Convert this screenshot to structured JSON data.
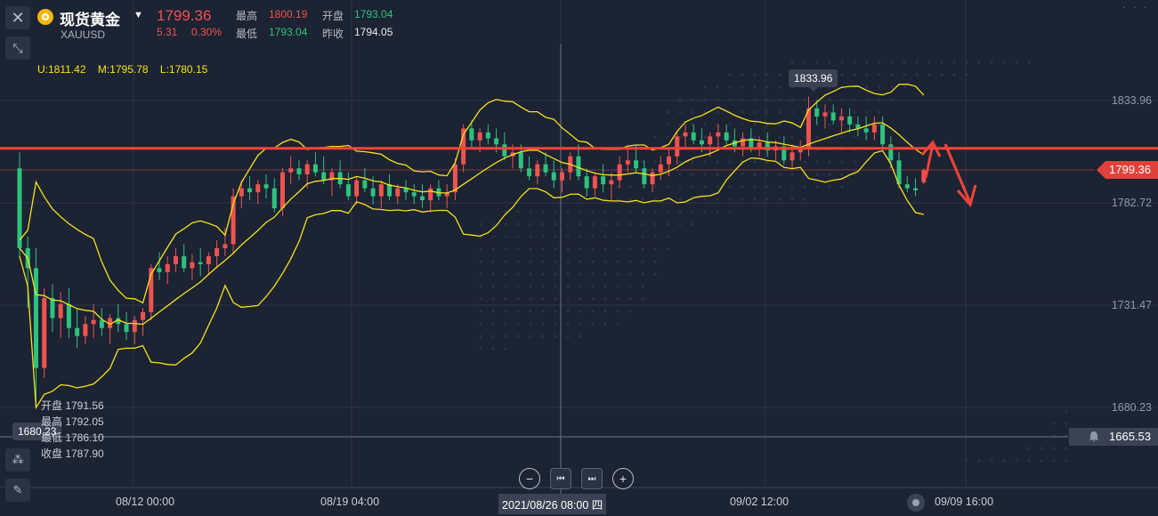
{
  "header": {
    "symbol_name": "现货黄金",
    "symbol_code": "XAUUSD",
    "last_price": "1799.36",
    "change": "5.31",
    "change_pct": "0.30%",
    "high_label": "最高",
    "high_value": "1800.19",
    "open_label": "开盘",
    "open_value": "1793.04",
    "low_label": "最低",
    "low_value": "1793.04",
    "prev_close_label": "昨收",
    "prev_close_value": "1794.05"
  },
  "indicator": {
    "upper": "U:1811.42",
    "middle": "M:1795.78",
    "lower": "L:1780.15",
    "color": "#f4e31d"
  },
  "y_axis": {
    "labels": [
      "1833.96",
      "1782.72",
      "1731.47",
      "1680.23"
    ],
    "current_price_tag": "1799.36",
    "low_tag": "1665.53"
  },
  "x_axis": {
    "labels": [
      "08/12 00:00",
      "08/19 04:00",
      "09/02 12:00",
      "09/09 16:00"
    ],
    "crosshair_date": "2021/08/26 08:00 四"
  },
  "markers": {
    "high_point": "1833.96",
    "low_point": "1680.23"
  },
  "ohlc_tooltip": {
    "open": "开盘 1791.56",
    "high": "最高 1792.05",
    "low": "最低 1786.10",
    "close": "收盘 1787.90"
  },
  "colors": {
    "up": "#ef5350",
    "down": "#2ec27e",
    "background": "#1c2333",
    "support_line": "#f0443a",
    "bollinger": "#f4e31d"
  },
  "chart_data": {
    "type": "candlestick",
    "ylim": [
      1665.53,
      1845
    ],
    "annotation_line": 1810,
    "candles": [
      {
        "o": 1800,
        "h": 1808,
        "l": 1755,
        "c": 1760
      },
      {
        "o": 1760,
        "h": 1766,
        "l": 1730,
        "c": 1750
      },
      {
        "o": 1750,
        "h": 1760,
        "l": 1680,
        "c": 1700
      },
      {
        "o": 1700,
        "h": 1740,
        "l": 1695,
        "c": 1735
      },
      {
        "o": 1735,
        "h": 1742,
        "l": 1718,
        "c": 1725
      },
      {
        "o": 1725,
        "h": 1738,
        "l": 1715,
        "c": 1732
      },
      {
        "o": 1732,
        "h": 1740,
        "l": 1715,
        "c": 1720
      },
      {
        "o": 1720,
        "h": 1730,
        "l": 1710,
        "c": 1716
      },
      {
        "o": 1716,
        "h": 1726,
        "l": 1712,
        "c": 1722
      },
      {
        "o": 1722,
        "h": 1732,
        "l": 1715,
        "c": 1724
      },
      {
        "o": 1724,
        "h": 1730,
        "l": 1716,
        "c": 1720
      },
      {
        "o": 1720,
        "h": 1727,
        "l": 1712,
        "c": 1725
      },
      {
        "o": 1725,
        "h": 1732,
        "l": 1718,
        "c": 1722
      },
      {
        "o": 1722,
        "h": 1728,
        "l": 1714,
        "c": 1718
      },
      {
        "o": 1718,
        "h": 1726,
        "l": 1712,
        "c": 1724
      },
      {
        "o": 1724,
        "h": 1730,
        "l": 1716,
        "c": 1728
      },
      {
        "o": 1728,
        "h": 1752,
        "l": 1724,
        "c": 1750
      },
      {
        "o": 1750,
        "h": 1758,
        "l": 1744,
        "c": 1748
      },
      {
        "o": 1748,
        "h": 1756,
        "l": 1742,
        "c": 1752
      },
      {
        "o": 1752,
        "h": 1760,
        "l": 1748,
        "c": 1756
      },
      {
        "o": 1756,
        "h": 1762,
        "l": 1748,
        "c": 1750
      },
      {
        "o": 1750,
        "h": 1757,
        "l": 1744,
        "c": 1753
      },
      {
        "o": 1753,
        "h": 1760,
        "l": 1746,
        "c": 1752
      },
      {
        "o": 1752,
        "h": 1758,
        "l": 1747,
        "c": 1756
      },
      {
        "o": 1756,
        "h": 1764,
        "l": 1750,
        "c": 1760
      },
      {
        "o": 1760,
        "h": 1770,
        "l": 1756,
        "c": 1762
      },
      {
        "o": 1762,
        "h": 1790,
        "l": 1758,
        "c": 1786
      },
      {
        "o": 1786,
        "h": 1794,
        "l": 1780,
        "c": 1790
      },
      {
        "o": 1790,
        "h": 1796,
        "l": 1784,
        "c": 1788
      },
      {
        "o": 1788,
        "h": 1794,
        "l": 1782,
        "c": 1792
      },
      {
        "o": 1792,
        "h": 1797,
        "l": 1785,
        "c": 1790
      },
      {
        "o": 1790,
        "h": 1795,
        "l": 1778,
        "c": 1780
      },
      {
        "o": 1780,
        "h": 1800,
        "l": 1776,
        "c": 1798
      },
      {
        "o": 1798,
        "h": 1806,
        "l": 1792,
        "c": 1800
      },
      {
        "o": 1800,
        "h": 1804,
        "l": 1794,
        "c": 1797
      },
      {
        "o": 1797,
        "h": 1804,
        "l": 1790,
        "c": 1802
      },
      {
        "o": 1802,
        "h": 1808,
        "l": 1796,
        "c": 1798
      },
      {
        "o": 1798,
        "h": 1806,
        "l": 1792,
        "c": 1794
      },
      {
        "o": 1794,
        "h": 1800,
        "l": 1786,
        "c": 1798
      },
      {
        "o": 1798,
        "h": 1804,
        "l": 1790,
        "c": 1792
      },
      {
        "o": 1792,
        "h": 1798,
        "l": 1784,
        "c": 1786
      },
      {
        "o": 1786,
        "h": 1796,
        "l": 1782,
        "c": 1794
      },
      {
        "o": 1794,
        "h": 1800,
        "l": 1788,
        "c": 1790
      },
      {
        "o": 1790,
        "h": 1796,
        "l": 1782,
        "c": 1786
      },
      {
        "o": 1786,
        "h": 1794,
        "l": 1780,
        "c": 1792
      },
      {
        "o": 1792,
        "h": 1797,
        "l": 1784,
        "c": 1786
      },
      {
        "o": 1786,
        "h": 1792,
        "l": 1782,
        "c": 1790
      },
      {
        "o": 1790,
        "h": 1794,
        "l": 1784,
        "c": 1788
      },
      {
        "o": 1788,
        "h": 1792,
        "l": 1782,
        "c": 1786
      },
      {
        "o": 1786,
        "h": 1792,
        "l": 1780,
        "c": 1784
      },
      {
        "o": 1784,
        "h": 1792,
        "l": 1778,
        "c": 1790
      },
      {
        "o": 1790,
        "h": 1794,
        "l": 1784,
        "c": 1786
      },
      {
        "o": 1786,
        "h": 1792,
        "l": 1780,
        "c": 1788
      },
      {
        "o": 1788,
        "h": 1805,
        "l": 1784,
        "c": 1802
      },
      {
        "o": 1802,
        "h": 1822,
        "l": 1798,
        "c": 1820
      },
      {
        "o": 1820,
        "h": 1824,
        "l": 1810,
        "c": 1814
      },
      {
        "o": 1814,
        "h": 1820,
        "l": 1808,
        "c": 1818
      },
      {
        "o": 1818,
        "h": 1822,
        "l": 1812,
        "c": 1815
      },
      {
        "o": 1815,
        "h": 1820,
        "l": 1808,
        "c": 1812
      },
      {
        "o": 1812,
        "h": 1818,
        "l": 1804,
        "c": 1806
      },
      {
        "o": 1806,
        "h": 1812,
        "l": 1800,
        "c": 1808
      },
      {
        "o": 1808,
        "h": 1812,
        "l": 1798,
        "c": 1800
      },
      {
        "o": 1800,
        "h": 1806,
        "l": 1794,
        "c": 1796
      },
      {
        "o": 1796,
        "h": 1804,
        "l": 1792,
        "c": 1802
      },
      {
        "o": 1802,
        "h": 1808,
        "l": 1796,
        "c": 1798
      },
      {
        "o": 1798,
        "h": 1804,
        "l": 1790,
        "c": 1794
      },
      {
        "o": 1794,
        "h": 1800,
        "l": 1788,
        "c": 1798
      },
      {
        "o": 1798,
        "h": 1808,
        "l": 1794,
        "c": 1806
      },
      {
        "o": 1806,
        "h": 1812,
        "l": 1794,
        "c": 1796
      },
      {
        "o": 1796,
        "h": 1800,
        "l": 1786,
        "c": 1790
      },
      {
        "o": 1790,
        "h": 1798,
        "l": 1786,
        "c": 1796
      },
      {
        "o": 1796,
        "h": 1802,
        "l": 1788,
        "c": 1792
      },
      {
        "o": 1792,
        "h": 1798,
        "l": 1784,
        "c": 1794
      },
      {
        "o": 1794,
        "h": 1806,
        "l": 1790,
        "c": 1802
      },
      {
        "o": 1802,
        "h": 1810,
        "l": 1798,
        "c": 1804
      },
      {
        "o": 1804,
        "h": 1812,
        "l": 1798,
        "c": 1800
      },
      {
        "o": 1800,
        "h": 1804,
        "l": 1790,
        "c": 1792
      },
      {
        "o": 1792,
        "h": 1800,
        "l": 1788,
        "c": 1798
      },
      {
        "o": 1798,
        "h": 1806,
        "l": 1794,
        "c": 1802
      },
      {
        "o": 1802,
        "h": 1810,
        "l": 1796,
        "c": 1806
      },
      {
        "o": 1806,
        "h": 1818,
        "l": 1802,
        "c": 1816
      },
      {
        "o": 1816,
        "h": 1822,
        "l": 1810,
        "c": 1818
      },
      {
        "o": 1818,
        "h": 1822,
        "l": 1812,
        "c": 1814
      },
      {
        "o": 1814,
        "h": 1820,
        "l": 1808,
        "c": 1812
      },
      {
        "o": 1812,
        "h": 1818,
        "l": 1806,
        "c": 1816
      },
      {
        "o": 1816,
        "h": 1822,
        "l": 1810,
        "c": 1818
      },
      {
        "o": 1818,
        "h": 1822,
        "l": 1812,
        "c": 1814
      },
      {
        "o": 1814,
        "h": 1820,
        "l": 1808,
        "c": 1811
      },
      {
        "o": 1811,
        "h": 1818,
        "l": 1806,
        "c": 1815
      },
      {
        "o": 1815,
        "h": 1820,
        "l": 1808,
        "c": 1810
      },
      {
        "o": 1810,
        "h": 1816,
        "l": 1806,
        "c": 1813
      },
      {
        "o": 1813,
        "h": 1818,
        "l": 1806,
        "c": 1809
      },
      {
        "o": 1809,
        "h": 1814,
        "l": 1804,
        "c": 1811
      },
      {
        "o": 1811,
        "h": 1816,
        "l": 1802,
        "c": 1804
      },
      {
        "o": 1804,
        "h": 1812,
        "l": 1800,
        "c": 1808
      },
      {
        "o": 1808,
        "h": 1814,
        "l": 1804,
        "c": 1810
      },
      {
        "o": 1810,
        "h": 1836,
        "l": 1806,
        "c": 1830
      },
      {
        "o": 1830,
        "h": 1834,
        "l": 1822,
        "c": 1826
      },
      {
        "o": 1826,
        "h": 1832,
        "l": 1820,
        "c": 1828
      },
      {
        "o": 1828,
        "h": 1832,
        "l": 1822,
        "c": 1824
      },
      {
        "o": 1824,
        "h": 1830,
        "l": 1818,
        "c": 1826
      },
      {
        "o": 1826,
        "h": 1830,
        "l": 1818,
        "c": 1822
      },
      {
        "o": 1822,
        "h": 1826,
        "l": 1816,
        "c": 1820
      },
      {
        "o": 1820,
        "h": 1826,
        "l": 1814,
        "c": 1818
      },
      {
        "o": 1818,
        "h": 1826,
        "l": 1814,
        "c": 1822
      },
      {
        "o": 1822,
        "h": 1826,
        "l": 1810,
        "c": 1812
      },
      {
        "o": 1812,
        "h": 1816,
        "l": 1800,
        "c": 1804
      },
      {
        "o": 1804,
        "h": 1808,
        "l": 1790,
        "c": 1792
      },
      {
        "o": 1792,
        "h": 1796,
        "l": 1788,
        "c": 1790
      },
      {
        "o": 1790,
        "h": 1795,
        "l": 1786,
        "c": 1789
      },
      {
        "o": 1793,
        "h": 1800,
        "l": 1792,
        "c": 1799
      }
    ]
  }
}
